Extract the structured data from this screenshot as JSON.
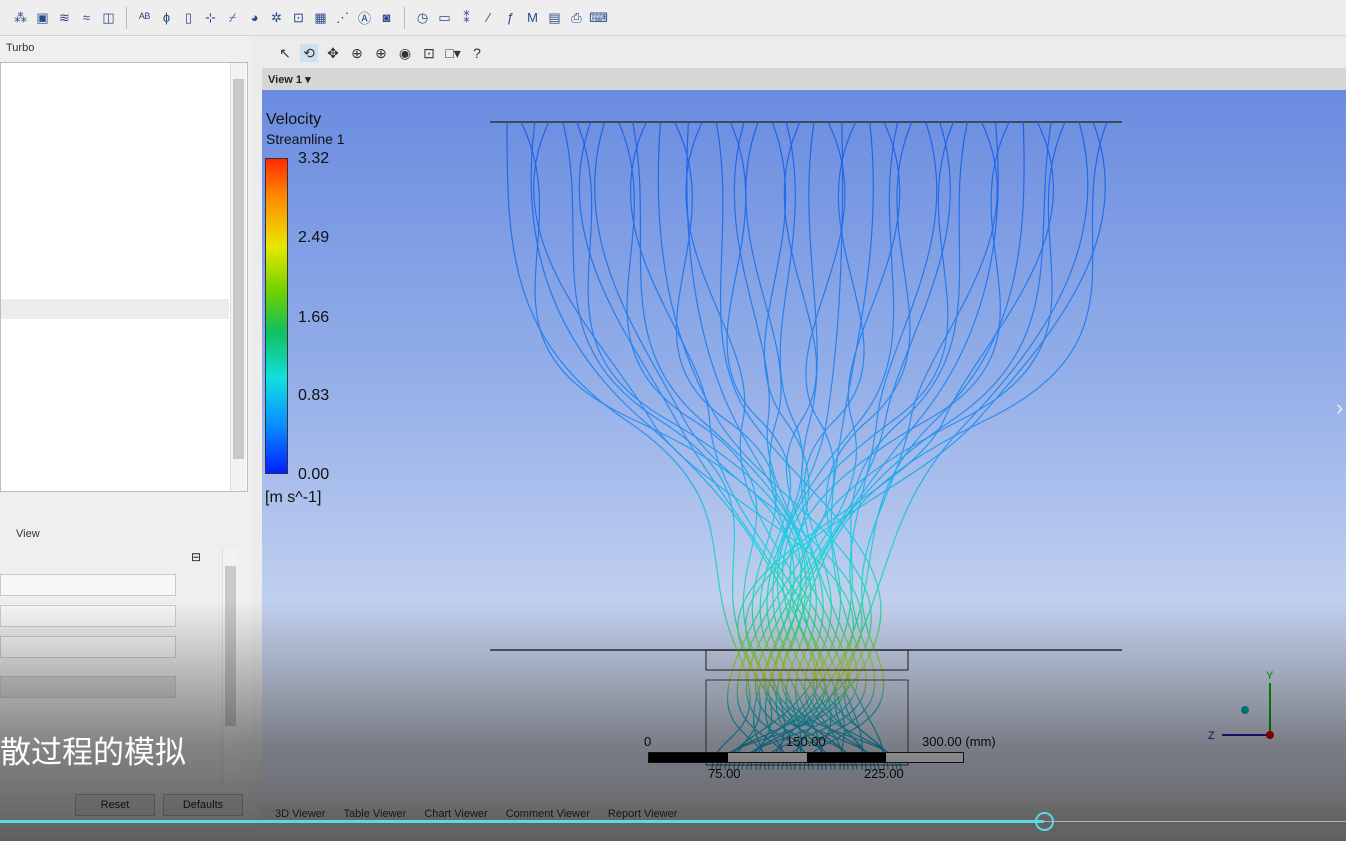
{
  "toolbar": {
    "icons": [
      "network-icon",
      "contour-icon",
      "streamline-icon",
      "vector-icon",
      "volume-icon",
      "text-icon",
      "clip-icon",
      "legend-icon",
      "probe-icon",
      "plane-icon",
      "color-icon",
      "expression-icon",
      "function-icon",
      "table-icon",
      "chart-icon",
      "annotation-icon",
      "image-icon",
      "timestep-icon",
      "animation-icon",
      "particle-icon",
      "pick-icon",
      "macro-icon",
      "report-icon",
      "mesh-icon",
      "print-icon",
      "console-icon"
    ]
  },
  "left_panel": {
    "top_tab": "Turbo",
    "bottom_tab": "View",
    "reset_label": "Reset",
    "defaults_label": "Defaults"
  },
  "view": {
    "title": "View 1"
  },
  "legend": {
    "title": "Velocity",
    "subtitle": "Streamline 1",
    "ticks": [
      "3.32",
      "2.49",
      "1.66",
      "0.83",
      "0.00"
    ],
    "units": "[m s^-1]"
  },
  "scale": {
    "labels_top": [
      "0",
      "150.00",
      "300.00 (mm)"
    ],
    "labels_bottom": [
      "75.00",
      "225.00"
    ]
  },
  "axis": {
    "y": "Y",
    "z": "Z"
  },
  "bottom_tabs": [
    "3D Viewer",
    "Table Viewer",
    "Chart Viewer",
    "Comment Viewer",
    "Report Viewer"
  ],
  "video": {
    "subtitle": "散过程的模拟",
    "progress_percent": 77.6
  },
  "colors": {
    "accent": "#5ad8e6",
    "view_bg": "#6a8ce0"
  }
}
